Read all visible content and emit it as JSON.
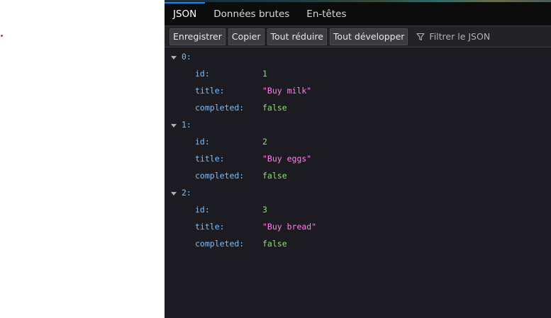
{
  "tabs": [
    {
      "label": "JSON",
      "active": true
    },
    {
      "label": "Données brutes",
      "active": false
    },
    {
      "label": "En-têtes",
      "active": false
    }
  ],
  "toolbar": {
    "save_label": "Enregistrer",
    "copy_label": "Copier",
    "collapse_all_label": "Tout réduire",
    "expand_all_label": "Tout développer",
    "filter_placeholder": "Filtrer le JSON",
    "filter_icon": "funnel-icon"
  },
  "json_items": [
    {
      "index": "0:",
      "props": [
        {
          "key": "id:",
          "value": "1",
          "type": "number"
        },
        {
          "key": "title:",
          "value": "\"Buy milk\"",
          "type": "string"
        },
        {
          "key": "completed:",
          "value": "false",
          "type": "bool"
        }
      ]
    },
    {
      "index": "1:",
      "props": [
        {
          "key": "id:",
          "value": "2",
          "type": "number"
        },
        {
          "key": "title:",
          "value": "\"Buy eggs\"",
          "type": "string"
        },
        {
          "key": "completed:",
          "value": "false",
          "type": "bool"
        }
      ]
    },
    {
      "index": "2:",
      "props": [
        {
          "key": "id:",
          "value": "3",
          "type": "number"
        },
        {
          "key": "title:",
          "value": "\"Buy bread\"",
          "type": "string"
        },
        {
          "key": "completed:",
          "value": "false",
          "type": "bool"
        }
      ]
    }
  ],
  "colors": {
    "background": "#1c1b22",
    "tab_bar": "#0c0c0d",
    "toolbar": "#232327",
    "active_tab_accent": "#0a84ff",
    "key": "#75bfff",
    "string": "#ff7de9",
    "number": "#86de74"
  }
}
